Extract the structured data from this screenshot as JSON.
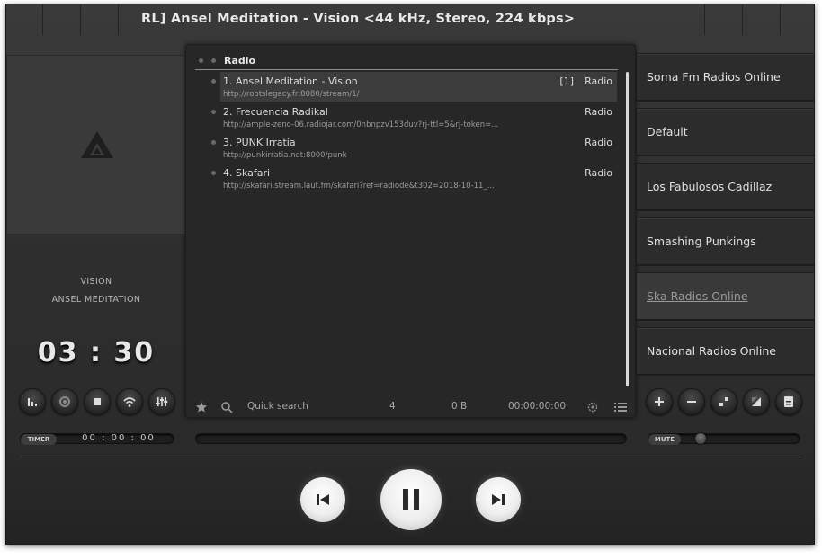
{
  "window": {
    "title": "RL] Ansel Meditation - Vision <44 kHz, Stereo, 224 kbps>"
  },
  "now_playing": {
    "title": "VISION",
    "artist": "ANSEL MEDITATION",
    "time": "03 : 30"
  },
  "timer": {
    "label": "TIMER",
    "value": "00 : 00 : 00"
  },
  "playlist": {
    "name": "Radio",
    "items": [
      {
        "name": "1. Ansel Meditation - Vision",
        "url": "http://rootslegacy.fr:8080/stream/1/",
        "count": "[1]",
        "genre": "Radio",
        "selected": true
      },
      {
        "name": "2. Frecuencia Radikal",
        "url": "http://ample-zeno-06.radiojar.com/0nbnpzv153duv?rj-ttl=5&rj-token=...",
        "count": "",
        "genre": "Radio",
        "selected": false
      },
      {
        "name": "3. PUNK Irratia",
        "url": "http://punkirratia.net:8000/punk",
        "count": "",
        "genre": "Radio",
        "selected": false
      },
      {
        "name": "4. Skafari",
        "url": "http://skafari.stream.laut.fm/skafari?ref=radiode&t302=2018-10-11_...",
        "count": "",
        "genre": "Radio",
        "selected": false
      }
    ],
    "footer": {
      "search_placeholder": "Quick search",
      "track_count": "4",
      "size": "0 B",
      "duration": "00:00:00:00"
    }
  },
  "playlist_tabs": [
    {
      "label": "Soma Fm Radios Online",
      "active": false
    },
    {
      "label": "Default",
      "active": false
    },
    {
      "label": "Los Fabulosos Cadillaz",
      "active": false
    },
    {
      "label": "Smashing Punkings",
      "active": false
    },
    {
      "label": "Ska Radios Online",
      "active": true
    },
    {
      "label": "Nacional Radios Online",
      "active": false
    }
  ],
  "volume": {
    "label": "MUTE",
    "level": 0.1
  },
  "icons": {
    "left_controls": [
      "equalizer-icon",
      "repeat-icon",
      "stop-icon",
      "wifi-icon",
      "mixer-icon"
    ],
    "right_controls": [
      "plus-icon",
      "minus-icon",
      "shuffle-icon",
      "sort-icon",
      "save-icon"
    ],
    "transport": [
      "previous-icon",
      "pause-icon",
      "next-icon"
    ]
  }
}
